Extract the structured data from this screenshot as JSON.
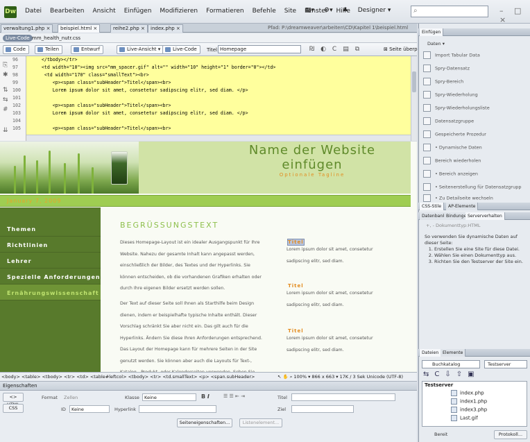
{
  "app": {
    "logo": "Dw",
    "menu": [
      "Datei",
      "Bearbeiten",
      "Ansicht",
      "Einfügen",
      "Modifizieren",
      "Formatieren",
      "Befehle",
      "Site",
      "Fenster",
      "Hilfe"
    ],
    "workspace": "Designer ▾",
    "window_controls": "– □ ×"
  },
  "doc_tabs": [
    "verwaltung1.php ×",
    "beispiel.html ×",
    "reihe2.php ×",
    "index.php ×"
  ],
  "doc_path": "Pfad: P:\\dreamweaver\\arbeiten\\CD\\Kapitel 1\\beispiel.html",
  "livebar": {
    "chip": "Live-Code",
    "file": "mm_health_nutr.css"
  },
  "toolbar": {
    "code": "Code",
    "split": "Teilen",
    "design": "Entwurf",
    "live_view": "Live-Ansicht ▾",
    "live_code": "Live-Code",
    "title_label": "Titel:",
    "title_value": "Homepage",
    "page_overview": "Seite überp"
  },
  "code": {
    "line_numbers": [
      "96",
      "97",
      "98",
      "99",
      "100",
      "101",
      "102",
      "103",
      "104",
      "105"
    ],
    "lines": [
      "    </tbody></tr>",
      "    <td width=\"10\"><img src=\"mm_spacer.gif\" alt=\"\" width=\"10\" height=\"1\" border=\"0\"></td>",
      "     <td width=\"170\" class=\"smallText\"><br>",
      "        <p><span class=\"subHeader\">Titel</span><br>",
      "        Lorem ipsum dolor sit amet, consetetur sadipscing elitr, sed diam. </p>",
      "",
      "        <p><span class=\"subHeader\">Titel</span><br>",
      "        Lorem ipsum dolor sit amet, consetetur sadipscing elitr, sed diam. </p>",
      "",
      "        <p><span class=\"subHeader\">Titel</span><br>"
    ]
  },
  "site": {
    "name_line1": "Name der Website",
    "name_line2": "einfügen",
    "tagline": "Optionale Tagline",
    "date": "January 7, 2009",
    "nav": [
      "Themen",
      "Richtlinien",
      "Lehrer",
      "Spezielle Anforderungen",
      "Ernährungswissenschaft"
    ],
    "heading": "BEGRÜSSUNGSTEXT",
    "para1": "Dieses Homepage-Layout ist ein idealer Ausgangspunkt für Ihre Website. Nahezu der gesamte Inhalt kann angepasst werden, einschließlich der Bilder, des Textes und der Hyperlinks. Sie können entscheiden, ob die vorhandenen Grafiken erhalten oder durch Ihre eigenen Bilder ersetzt werden sollen.",
    "para2": "Der Text auf dieser Seite soll Ihnen als Starthilfe beim Design dienen, indem er beispielhafte typische Inhalte enthält. Dieser Vorschlag schränkt Sie aber nicht ein. Das gilt auch für die Hyperlinks. Ändern Sie diese Ihren Anforderungen entsprechend. Das Layout der Homepage kann für mehrere Seiten in der Site genutzt werden. Sie können aber auch die Layouts für Text-, Katalog-, Produkt- oder Kalenderseiten verwenden. Sehen Sie kreativ und kombinieren Sie",
    "right_title": "Titel",
    "right_text": "Lorem ipsum dolor sit amet, consetetur sadipscing elitr, sed diam."
  },
  "tag_selector": "<body> <table> <tbody> <tr> <td> <table#leftcol> <tbody> <tr> <td.smallText> <p> <span.subHeader>",
  "status": {
    "zoom": "100%",
    "size": "866 x 663 ▾",
    "info": "17K / 3 Sek  Unicode (UTF-8)"
  },
  "properties": {
    "title": "Eigenschaften",
    "html": "<> HTML",
    "css": "CSS",
    "format_label": "Format",
    "format_value": "Zellen",
    "class_label": "Klasse",
    "class_value": "Keine",
    "id_label": "ID",
    "id_value": "Keine",
    "link_label": "Hyperlink",
    "title_label": "Titel",
    "target_label": "Ziel",
    "page_props": "Seiteneigenschaften...",
    "list_item": "Listenelement..."
  },
  "panels": {
    "insert_tab": "Einfügen",
    "insert_category": "Daten ▾",
    "insert_items": [
      "Import Tabular Data",
      "Spry-Datensatz",
      "Spry-Bereich",
      "Spry-Wiederholung",
      "Spry-Wiederholungsliste",
      "Datensatzgruppe",
      "Gespeicherte Prozedur",
      "• Dynamische Daten",
      "Bereich wiederholen",
      "• Bereich anzeigen",
      "• Seitenerstellung für Datensatzgrupp",
      "• Zu Detailseite wechseln"
    ],
    "css_tabs": [
      "CSS-Stile",
      "AP-Elemente"
    ],
    "db_tabs": [
      "Datenbank",
      "Bindungen",
      "Serververhalten"
    ],
    "doctype": "+, - Dokumenttyp:HTML",
    "help_intro": "So verwenden Sie dynamische Daten auf dieser Seite:",
    "help_steps": [
      "Erstellen Sie eine Site für diese Datei.",
      "Wählen Sie einen Dokumenttyp aus.",
      "Richten Sie den Testserver der Site ein."
    ],
    "files_tabs": [
      "Dateien",
      "Elemente"
    ],
    "site_combo": "Buchkatalog",
    "server_combo": "Testserver",
    "tree_root": "Testserver",
    "files": [
      "index.php",
      "index1.php",
      "index3.php",
      "Last.gif"
    ],
    "status": "Bereit",
    "log_button": "Protokoll..."
  }
}
